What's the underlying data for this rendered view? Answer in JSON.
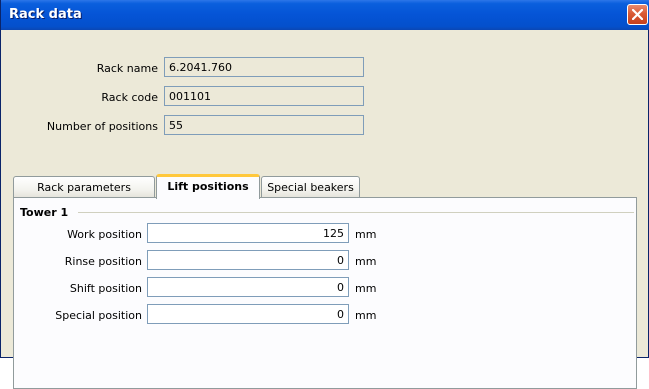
{
  "window": {
    "title": "Rack data"
  },
  "info": [
    {
      "label": "Rack name",
      "value": "6.2041.760"
    },
    {
      "label": "Rack code",
      "value": "001101"
    },
    {
      "label": "Number of positions",
      "value": "55"
    }
  ],
  "tabs": [
    {
      "label": "Rack parameters",
      "active": false
    },
    {
      "label": "Lift positions",
      "active": true
    },
    {
      "label": "Special beakers",
      "active": false
    }
  ],
  "group": {
    "title": "Tower 1",
    "fields": [
      {
        "label": "Work position",
        "value": "125",
        "unit": "mm"
      },
      {
        "label": "Rinse position",
        "value": "0",
        "unit": "mm"
      },
      {
        "label": "Shift position",
        "value": "0",
        "unit": "mm"
      },
      {
        "label": "Special position",
        "value": "0",
        "unit": "mm"
      }
    ]
  },
  "icons": {
    "close": "close-icon"
  },
  "colors": {
    "titlebar": "#0554d6",
    "close_button": "#d95a35",
    "active_tab_accent": "#ffc83c"
  }
}
